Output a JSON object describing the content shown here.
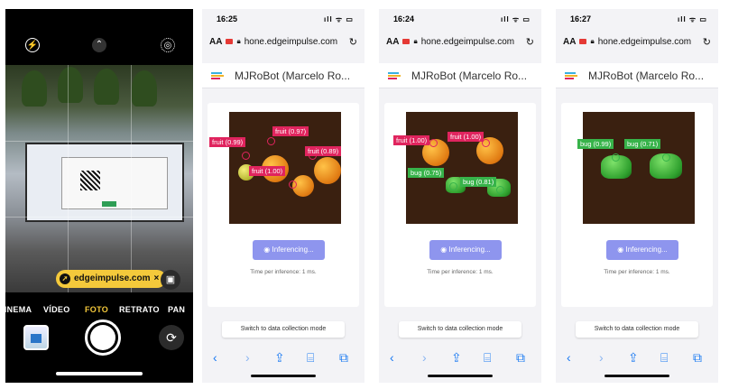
{
  "camera": {
    "modes": [
      "CINEMA",
      "VÍDEO",
      "FOTO",
      "RETRATO",
      "PAN"
    ],
    "active_mode": "FOTO",
    "qr_pill": "edgeimpulse.com",
    "qr_pill_close": "×",
    "icons": [
      "flash-icon",
      "chevron-up-icon",
      "live-photo-icon",
      "scan-text-icon",
      "flip-camera-icon"
    ]
  },
  "browsers": [
    {
      "time": "16:25",
      "signal": "ıll ᯤ ▭",
      "text_size": "AA",
      "url": "hone.edgeimpulse.com",
      "page_title": "MJRoBot (Marcelo Ro...",
      "boxes": [
        {
          "label": "fruit (0.97)",
          "kind": "fruit"
        },
        {
          "label": "fruit (0.99)",
          "kind": "fruit"
        },
        {
          "label": "fruit (0.89)",
          "kind": "fruit"
        },
        {
          "label": "fruit (1.00)",
          "kind": "fruit"
        }
      ],
      "inferencing": "Inferencing...",
      "time_per_inference": "Time per inference: 1 ms.",
      "switch_label": "Switch to data collection mode"
    },
    {
      "time": "16:24",
      "signal": "ıll ᯤ ▭",
      "text_size": "AA",
      "url": "hone.edgeimpulse.com",
      "page_title": "MJRoBot (Marcelo Ro...",
      "boxes": [
        {
          "label": "fruit (1.00)",
          "kind": "fruit"
        },
        {
          "label": "fruit (1.00)",
          "kind": "fruit"
        },
        {
          "label": "bug (0.75)",
          "kind": "bug"
        },
        {
          "label": "bug (0.81)",
          "kind": "bug"
        }
      ],
      "inferencing": "Inferencing...",
      "time_per_inference": "Time per inference: 1 ms.",
      "switch_label": "Switch to data collection mode"
    },
    {
      "time": "16:27",
      "signal": "ıll ᯤ ▭",
      "text_size": "AA",
      "url": "hone.edgeimpulse.com",
      "page_title": "MJRoBot (Marcelo Ro...",
      "boxes": [
        {
          "label": "bug (0.99)",
          "kind": "bug"
        },
        {
          "label": "bug (0.71)",
          "kind": "bug"
        }
      ],
      "inferencing": "Inferencing...",
      "time_per_inference": "Time per inference: 1 ms.",
      "switch_label": "Switch to data collection mode"
    }
  ],
  "toolbar_icons": [
    "back-icon",
    "forward-icon",
    "share-icon",
    "bookmarks-icon",
    "tabs-icon"
  ],
  "colors": {
    "fruit_box": "#e0245e",
    "bug_box": "#37b34a",
    "inference_button": "#8e95ee",
    "safari_blue": "#1a7af2",
    "qr_pill": "#f4c93b"
  }
}
